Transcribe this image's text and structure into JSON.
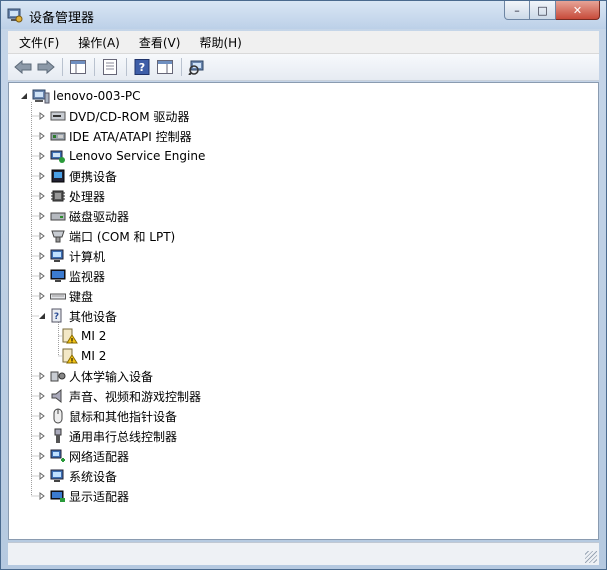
{
  "window": {
    "title": "设备管理器"
  },
  "window_controls": {
    "minimize": "–",
    "maximize": "□",
    "close": "✕"
  },
  "menu": [
    {
      "label": "文件(F)"
    },
    {
      "label": "操作(A)"
    },
    {
      "label": "查看(V)"
    },
    {
      "label": "帮助(H)"
    }
  ],
  "tree": {
    "root": {
      "label": "lenovo-003-PC"
    },
    "categories": [
      {
        "label": "DVD/CD-ROM 驱动器",
        "icon": "dvd-drive-icon"
      },
      {
        "label": "IDE ATA/ATAPI 控制器",
        "icon": "ide-controller-icon"
      },
      {
        "label": "Lenovo Service Engine",
        "icon": "lenovo-service-icon"
      },
      {
        "label": "便携设备",
        "icon": "portable-device-icon"
      },
      {
        "label": "处理器",
        "icon": "processor-icon"
      },
      {
        "label": "磁盘驱动器",
        "icon": "disk-drive-icon"
      },
      {
        "label": "端口 (COM 和 LPT)",
        "icon": "port-icon"
      },
      {
        "label": "计算机",
        "icon": "computer-icon"
      },
      {
        "label": "监视器",
        "icon": "monitor-icon"
      },
      {
        "label": "键盘",
        "icon": "keyboard-icon"
      },
      {
        "label": "其他设备",
        "icon": "unknown-device-icon",
        "expanded": true,
        "children": [
          {
            "label": "MI 2"
          },
          {
            "label": "MI 2"
          }
        ]
      },
      {
        "label": "人体学输入设备",
        "icon": "hid-icon"
      },
      {
        "label": "声音、视频和游戏控制器",
        "icon": "speaker-icon"
      },
      {
        "label": "鼠标和其他指针设备",
        "icon": "mouse-icon"
      },
      {
        "label": "通用串行总线控制器",
        "icon": "usb-icon"
      },
      {
        "label": "网络适配器",
        "icon": "network-adapter-icon"
      },
      {
        "label": "系统设备",
        "icon": "system-device-icon"
      },
      {
        "label": "显示适配器",
        "icon": "display-adapter-icon"
      }
    ]
  }
}
